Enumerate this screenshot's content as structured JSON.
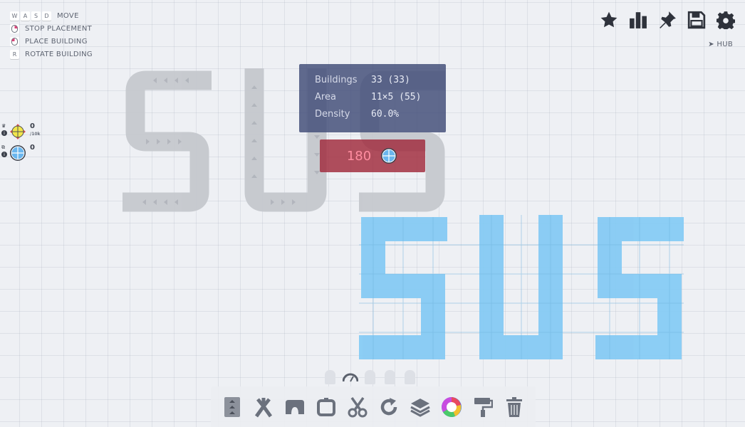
{
  "keyhints": [
    {
      "keys": [
        "W",
        "A",
        "S",
        "D"
      ],
      "label": "MOVE"
    },
    {
      "mouse": "right",
      "label": "STOP PLACEMENT"
    },
    {
      "mouse": "left",
      "label": "PLACE BUILDING"
    },
    {
      "keys": [
        "R"
      ],
      "label": "ROTATE BUILDING"
    }
  ],
  "topbar": {
    "icons": [
      "star-icon",
      "stats-icon",
      "pin-icon",
      "save-icon",
      "settings-icon"
    ],
    "hub_label": "HUB"
  },
  "pinned": [
    {
      "count": "0",
      "sub": "/10k",
      "icon": "target-shape-icon"
    },
    {
      "count": "0",
      "sub": "",
      "icon": "circle-shape-icon"
    }
  ],
  "stats": {
    "buildings_label": "Buildings",
    "buildings_value": "33 (33)",
    "area_label": "Area",
    "area_value": "11×5 (55)",
    "density_label": "Density",
    "density_value": "60.0%"
  },
  "cost": {
    "value": "180"
  },
  "ghost_text": "SUS",
  "placed_text": "SUS",
  "colors": {
    "belt_gray": "#c9ccd1",
    "belt_blue": "#80c8f4",
    "stats_bg": "#404a76",
    "cost_bg": "#a0283a"
  },
  "toolbar": [
    "belt-tool-icon",
    "splitter-tool-icon",
    "tunnel-tool-icon",
    "extractor-tool-icon",
    "cutter-tool-icon",
    "rotator-tool-icon",
    "stacker-tool-icon",
    "mixer-tool-icon",
    "painter-tool-icon",
    "trash-tool-icon"
  ]
}
